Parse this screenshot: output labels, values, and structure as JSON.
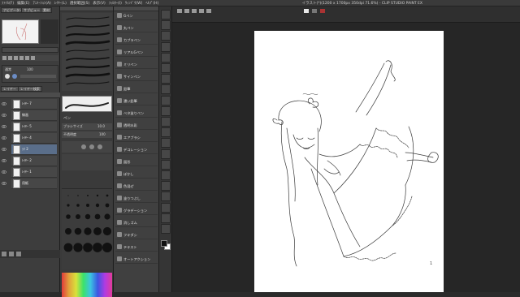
{
  "menubar": {
    "items": [
      "ﾌｧｲﾙ(F)",
      "編集(E)",
      "ｱﾆﾒｰｼｮﾝ(A)",
      "ﾚｲﾔｰ(L)",
      "選択範囲(S)",
      "表示(V)",
      "ﾌｨﾙﾀｰ(I)",
      "ｳｨﾝﾄﾞｳ(W)",
      "ﾍﾙﾌﾟ(H)"
    ],
    "doc_title": "イラスト(*)(1200 x 1700px 350dpi 71.6%) - CLIP STUDIO PAINT EX"
  },
  "left_panel": {
    "tabs": [
      "ナビゲーター",
      "サブビュー",
      "素材"
    ],
    "layer_tabs": [
      "レイヤー",
      "レイヤー検索"
    ],
    "blend_mode": "通常",
    "opacity": "100",
    "layers": [
      {
        "name": "ﾚｲﾔｰ 7",
        "selected": false
      },
      {
        "name": "線画",
        "selected": false
      },
      {
        "name": "ﾚｲﾔｰ 5",
        "selected": false
      },
      {
        "name": "ﾚｲﾔｰ 4",
        "selected": false
      },
      {
        "name": "ﾗﾌ 2",
        "selected": true
      },
      {
        "name": "ﾚｲﾔｰ 2",
        "selected": false
      },
      {
        "name": "ﾚｲﾔｰ 1",
        "selected": false
      },
      {
        "name": "用紙",
        "selected": false
      }
    ]
  },
  "mid_panel": {
    "subtool_title": "ペン",
    "brush_size_label": "ブラシサイズ",
    "brush_size": "10.0",
    "opacity_label": "不透明度",
    "opacity_val": "100"
  },
  "tool_panel": {
    "items": [
      "Gペン",
      "丸ペン",
      "カブラペン",
      "リアルGペン",
      "ミリペン",
      "サインペン",
      "鉛筆",
      "濃い鉛筆",
      "ベタ塗りペン",
      "透明水彩",
      "エアブラシ",
      "デコレーション",
      "図形",
      "ぼかし",
      "色混ぜ",
      "塗りつぶし",
      "グラデーション",
      "消しゴム",
      "フキダシ",
      "テキスト",
      "オートアクション"
    ]
  },
  "canvas": {
    "page_number": "1"
  },
  "colors": {
    "ui_bg": "#3a3a3a",
    "canvas_bg": "#262626",
    "paper": "#ffffff",
    "selection": "#5a6e8a"
  }
}
